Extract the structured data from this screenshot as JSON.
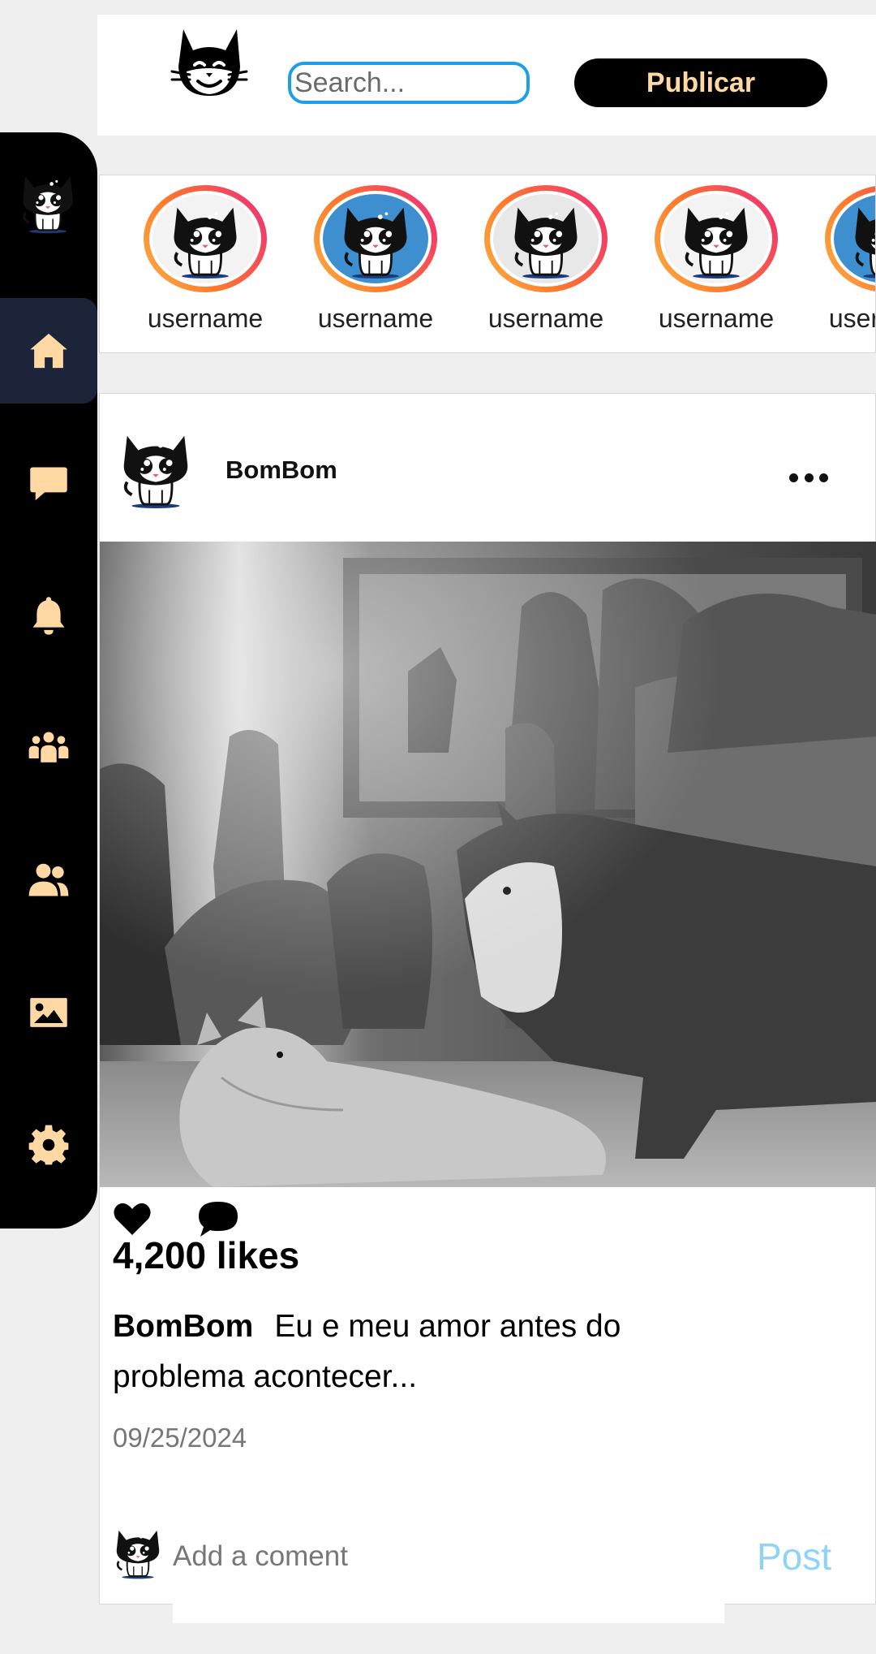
{
  "header": {
    "logo_icon": "cat-face-logo-icon",
    "search_placeholder": "Search...",
    "publish_label": "Publicar"
  },
  "sidebar": {
    "avatar_icon": "cat-avatar-icon",
    "items": [
      {
        "icon": "home-icon",
        "active": true
      },
      {
        "icon": "chat-bubble-icon"
      },
      {
        "icon": "bell-icon"
      },
      {
        "icon": "groups-icon"
      },
      {
        "icon": "friends-icon"
      },
      {
        "icon": "image-icon"
      },
      {
        "icon": "gear-icon"
      }
    ]
  },
  "stories": [
    {
      "label": "username"
    },
    {
      "label": "username"
    },
    {
      "label": "username"
    },
    {
      "label": "username"
    },
    {
      "label": "username"
    }
  ],
  "post": {
    "username": "BomBom",
    "likes": "4,200 likes",
    "caption_user": "BomBom",
    "caption_text": "Eu e meu amor antes do problema acontecer...",
    "date": "09/25/2024",
    "comment_placeholder": "Add a coment",
    "post_label": "Post"
  },
  "colors": {
    "accent": "#ffd8a3",
    "search_border": "#1a9fe8",
    "post_button": "#8fd3f7",
    "sidebar_active": "#1b2438"
  }
}
